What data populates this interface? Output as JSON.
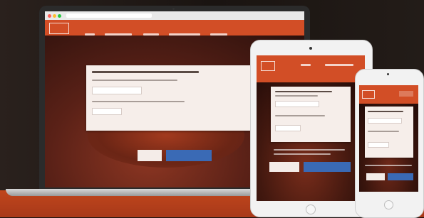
{
  "colors": {
    "brand_orange": "#d24e26",
    "table_orange": "#b63f1b",
    "hero_dark": "#2a100c",
    "card_bg": "#f6eeea",
    "primary_blue": "#3a6ab5",
    "device_silver": "#f2f2f2",
    "laptop_bezel": "#2b2b2b"
  },
  "devices": [
    "laptop",
    "tablet",
    "phone"
  ],
  "icons": [
    "logo-icon",
    "camera-icon",
    "home-button-icon"
  ]
}
